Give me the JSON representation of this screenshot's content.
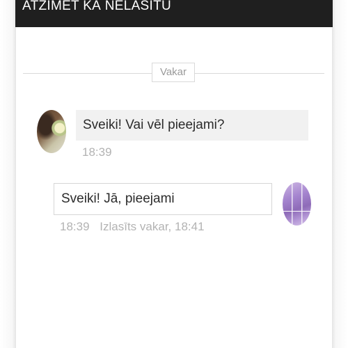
{
  "header": {
    "title": "ATZĪMĒT KĀ NELASĪTU"
  },
  "divider": {
    "label": "Vakar"
  },
  "messages": {
    "incoming": {
      "text": "Sveiki! Vai vēl pieejami?",
      "time": "18:39"
    },
    "outgoing": {
      "text": "Sveiki! Jā, pieejami",
      "time": "18:39",
      "status": "Izlasīts vakar, 18:41"
    }
  },
  "colors": {
    "header_bg": "#1f1f1f",
    "incoming_bubble": "#f1f1f1",
    "muted_text": "#b3b3b3"
  }
}
